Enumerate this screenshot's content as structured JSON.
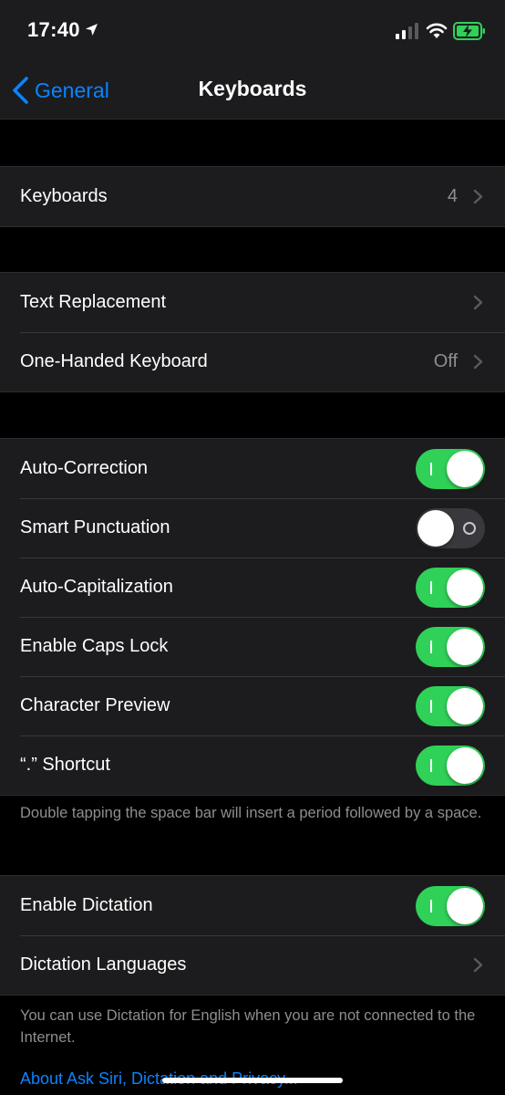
{
  "status_bar": {
    "time": "17:40"
  },
  "nav": {
    "back_label": "General",
    "title": "Keyboards"
  },
  "groups": {
    "keyboards": {
      "label": "Keyboards",
      "value": "4"
    },
    "text": {
      "text_replacement": {
        "label": "Text Replacement"
      },
      "one_handed": {
        "label": "One-Handed Keyboard",
        "value": "Off"
      }
    },
    "toggles": [
      {
        "label": "Auto-Correction",
        "state": "on"
      },
      {
        "label": "Smart Punctuation",
        "state": "off"
      },
      {
        "label": "Auto-Capitalization",
        "state": "on"
      },
      {
        "label": "Enable Caps Lock",
        "state": "on"
      },
      {
        "label": "Character Preview",
        "state": "on"
      },
      {
        "label": "“.” Shortcut",
        "state": "on"
      }
    ],
    "period_footer": "Double tapping the space bar will insert a period followed by a space.",
    "dictation": {
      "enable": {
        "label": "Enable Dictation",
        "state": "on"
      },
      "languages": {
        "label": "Dictation Languages"
      }
    },
    "dictation_footer": "You can use Dictation for English when you are not connected to the Internet.",
    "about_link": "About Ask Siri, Dictation and Privacy..."
  },
  "colors": {
    "accent": "#0a84ff",
    "toggle_on": "#30d158",
    "background": "#000000",
    "cell": "#1c1c1e"
  }
}
